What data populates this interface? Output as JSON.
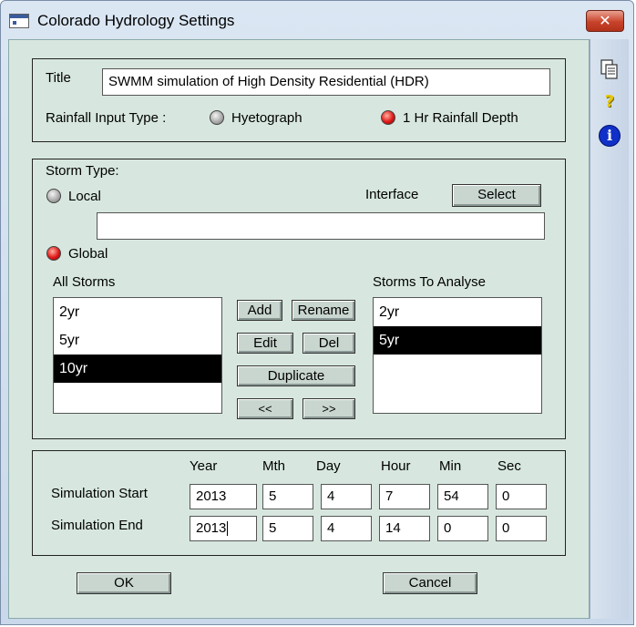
{
  "window": {
    "title": "Colorado Hydrology Settings",
    "close_glyph": "✕"
  },
  "toolbar": {
    "icons": [
      "copy-icon",
      "help-icon",
      "info-icon"
    ],
    "help_glyph": "?",
    "info_glyph": "i"
  },
  "general": {
    "title_label": "Title",
    "title_value": "SWMM  simulation of High Density Residential (HDR)",
    "rainfall_label": "Rainfall Input Type :",
    "hyetograph_label": "Hyetograph",
    "rainfall_depth_label": "1 Hr Rainfall Depth",
    "selected_rainfall": "1 Hr Rainfall Depth"
  },
  "storm": {
    "storm_type_label": "Storm Type:",
    "local_label": "Local",
    "global_label": "Global",
    "selected_type": "Global",
    "interface_label": "Interface",
    "select_button": "Select",
    "interface_value": "",
    "all_storms_label": "All Storms",
    "all_storms": [
      "2yr",
      "5yr",
      "10yr"
    ],
    "all_storms_selected": "10yr",
    "analyse_label": "Storms To Analyse",
    "analyse_storms": [
      "2yr",
      "5yr"
    ],
    "analyse_selected": "5yr",
    "buttons": {
      "add": "Add",
      "rename": "Rename",
      "edit": "Edit",
      "del": "Del",
      "duplicate": "Duplicate",
      "move_left": "<<",
      "move_right": ">>"
    }
  },
  "simulation": {
    "headers": [
      "Year",
      "Mth",
      "Day",
      "Hour",
      "Min",
      "Sec"
    ],
    "start_label": "Simulation Start",
    "end_label": "Simulation End",
    "start": [
      "2013",
      "5",
      "4",
      "7",
      "54",
      "0"
    ],
    "end": [
      "2013",
      "5",
      "4",
      "14",
      "0",
      "0"
    ]
  },
  "footer": {
    "ok": "OK",
    "cancel": "Cancel"
  },
  "colors": {
    "client_bg": "#d7e7df",
    "selected_bg": "#000000",
    "close_red": "#c8432b",
    "radio_on": "#e01818"
  }
}
